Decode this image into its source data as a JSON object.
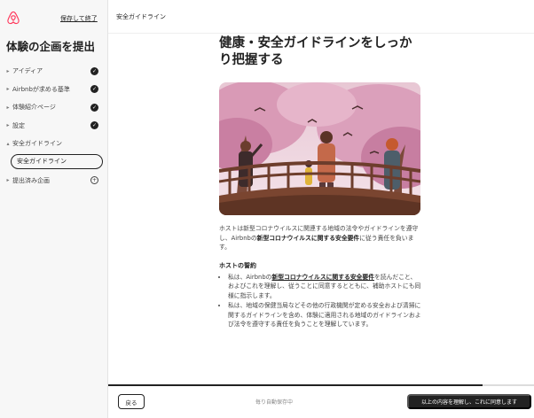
{
  "sidebar": {
    "save_exit": "保存して終了",
    "title": "体験の企画を提出",
    "steps": [
      {
        "label": "アイディア",
        "status": "done"
      },
      {
        "label": "Airbnbが求める基準",
        "status": "done"
      },
      {
        "label": "体験紹介ページ",
        "status": "done"
      },
      {
        "label": "設定",
        "status": "done"
      },
      {
        "label": "安全ガイドライン",
        "status": "expanded"
      }
    ],
    "active_sub_step": "安全ガイドライン",
    "submitted": {
      "label": "提出済み企画",
      "status": "add"
    }
  },
  "topbar": {
    "title": "安全ガイドライン"
  },
  "main": {
    "heading": "健康・安全ガイドラインをしっかり把握する",
    "para_pre": "ホストは新型コロナウイルスに関連する地域の法令やガイドラインを遵守し、Airbnbの",
    "para_bold": "新型コロナウイルスに関する安全要件",
    "para_post": "に従う責任を負います。",
    "pledge_title": "ホストの誓約",
    "bullet1_pre": "私は、Airbnbの",
    "bullet1_bold": "新型コロナウイルスに関する安全要件",
    "bullet1_post": "を読んだこと、およびこれを理解し、従うことに同意するとともに、補助ホストにも同様に指示します。",
    "bullet2": "私は、地域の保健当局などその他の行政機関が定める安全および清掃に関するガイドラインを含め、体験に適用される地域のガイドラインおよび法令を遵守する責任を負うことを理解しています。"
  },
  "footer": {
    "back": "戻る",
    "autosave": "毎り自動保存中",
    "agree": "以上の内容を理解し、これに同意します",
    "progress": 0.88
  },
  "colors": {
    "brand": "#ff385c",
    "dark": "#222222",
    "sidebar_bg": "#f7f7f7"
  }
}
